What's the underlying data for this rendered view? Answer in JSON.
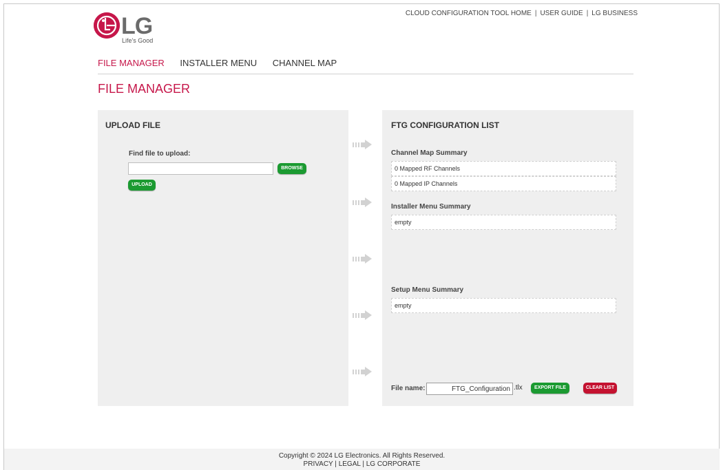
{
  "brand": {
    "logo_text": "LG",
    "tagline": "Life's Good",
    "brand_color": "#c6174a"
  },
  "top_links": [
    "CLOUD CONFIGURATION TOOL HOME",
    "USER GUIDE",
    "LG BUSINESS"
  ],
  "nav": {
    "items": [
      {
        "label": "FILE MANAGER",
        "active": true
      },
      {
        "label": "INSTALLER MENU",
        "active": false
      },
      {
        "label": "CHANNEL MAP",
        "active": false
      }
    ]
  },
  "page_title": "FILE MANAGER",
  "upload_panel": {
    "title": "UPLOAD FILE",
    "find_label": "Find file to upload:",
    "file_value": "",
    "browse_label": "BROWSE",
    "upload_label": "UPLOAD"
  },
  "config_panel": {
    "title": "FTG CONFIGURATION LIST",
    "channel_map": {
      "label": "Channel Map Summary",
      "rows": [
        "0 Mapped RF Channels",
        "0 Mapped IP Channels"
      ]
    },
    "installer_menu": {
      "label": "Installer Menu Summary",
      "value": "empty"
    },
    "setup_menu": {
      "label": "Setup Menu Summary",
      "value": "empty"
    },
    "file_name_label": "File name:",
    "file_name_value": "FTG_Configuration",
    "file_ext": ".tlx",
    "export_label": "EXPORT FILE",
    "clear_label": "CLEAR LIST"
  },
  "footer": {
    "copyright": "Copyright © 2024 LG Electronics. All Rights Reserved.",
    "links": [
      "PRIVACY",
      "LEGAL",
      "LG CORPORATE"
    ]
  },
  "colors": {
    "panel_bg": "#efefef",
    "green_button": "#1b9a31",
    "red_button": "#c41230"
  }
}
